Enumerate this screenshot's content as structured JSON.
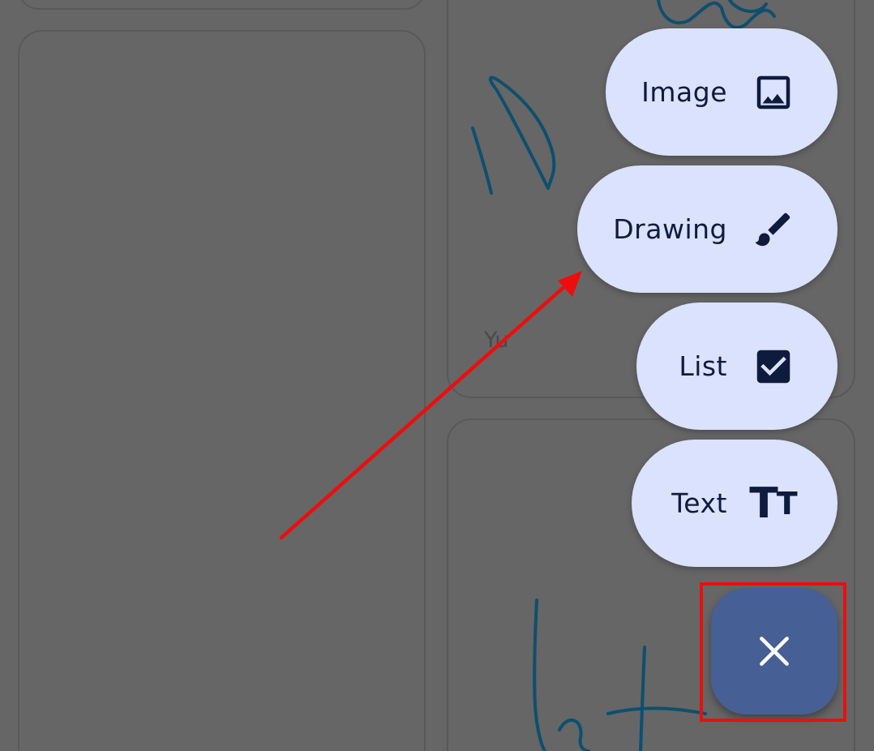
{
  "menu": {
    "items": [
      {
        "label": "Image",
        "icon": "image-icon"
      },
      {
        "label": "Drawing",
        "icon": "brush-icon"
      },
      {
        "label": "List",
        "icon": "checkbox-icon"
      },
      {
        "label": "Text",
        "icon": "text-format-icon"
      }
    ],
    "text_icon_glyphs": {
      "big": "T",
      "small": "T"
    },
    "close_icon": "close-icon"
  },
  "notes": {
    "partial_text": "Yu"
  },
  "colors": {
    "scrim": "#666666",
    "menu_item_bg": "#dae2fd",
    "menu_item_text": "#0f1b3d",
    "close_fab_bg": "#465f95",
    "scribble_ink": "#0e4f6e",
    "annotation_red": "#ee0d0d"
  }
}
